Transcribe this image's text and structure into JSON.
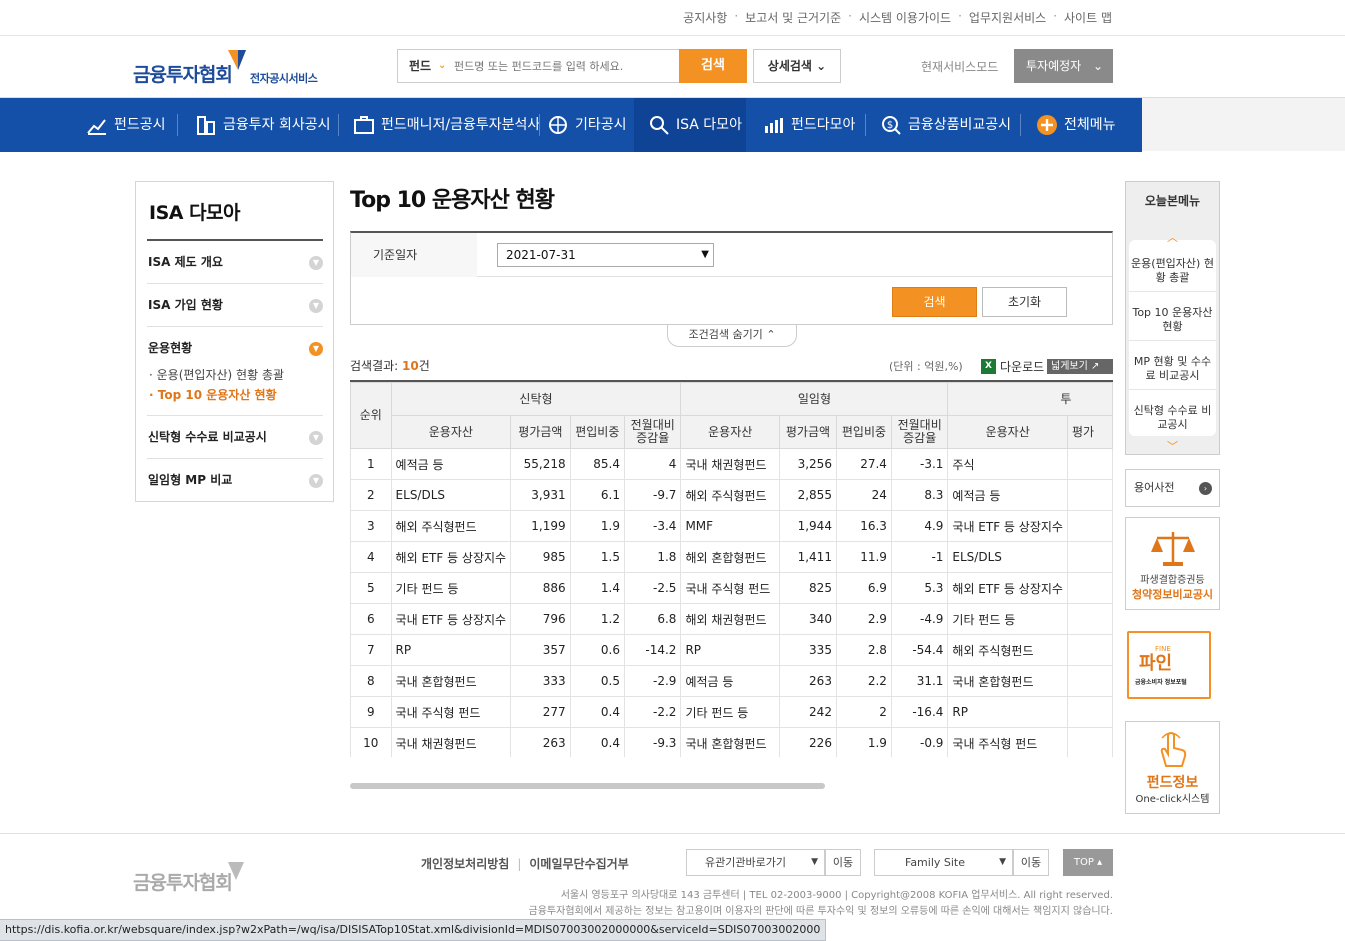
{
  "util_links": [
    "공지사항",
    "보고서 및 근거기준",
    "시스템 이용가이드",
    "업무지원서비스",
    "사이트 맵"
  ],
  "header": {
    "logo_main": "금융투자협회",
    "logo_sub": "전자공시서비스",
    "search_type": "펀드",
    "search_placeholder": "펀드명 또는 펀드코드를 입력 하세요.",
    "search_button": "검색",
    "detail_search": "상세검색",
    "mode_label": "현재서비스모드",
    "mode_value": "투자예정자"
  },
  "nav": {
    "items": [
      "펀드공시",
      "금융투자 회사공시",
      "펀드매니저/금융투자분석사",
      "기타공시",
      "ISA 다모아",
      "펀드다모아",
      "금융상품비교공시",
      "전체메뉴"
    ]
  },
  "sidebar": {
    "title": "ISA 다모아",
    "items": [
      "ISA 제도 개요",
      "ISA 가입 현황",
      "운용현황",
      "신탁형 수수료 비교공시",
      "일임형 MP 비교"
    ],
    "subitems": [
      "· 운용(편입자산) 현황 총괄",
      "· Top 10 운용자산 현황"
    ]
  },
  "main": {
    "title": "Top 10 운용자산 현황",
    "cond_label": "기준일자",
    "cond_value": "2021-07-31",
    "btn_search": "검색",
    "btn_reset": "초기화",
    "toggle": "조건검색 숨기기",
    "result_label": "검색결과:",
    "result_count": "10",
    "result_suffix": "건",
    "unit": "(단위 : 억원,%)",
    "download": "다운로드",
    "wide_view": "넓게보기"
  },
  "table": {
    "rank_header": "순위",
    "group_headers": [
      "신탁형",
      "일임형",
      "투"
    ],
    "col_headers": [
      "운용자산",
      "평가금액",
      "편입비중",
      "전월대비\n증감율"
    ],
    "col_headers_partial": [
      "운용자산",
      "평가"
    ],
    "rows": [
      [
        "1",
        "예적금 등",
        "55,218",
        "85.4",
        "4",
        "국내 채권형펀드",
        "3,256",
        "27.4",
        "-3.1",
        "주식"
      ],
      [
        "2",
        "ELS/DLS",
        "3,931",
        "6.1",
        "-9.7",
        "해외 주식형펀드",
        "2,855",
        "24",
        "8.3",
        "예적금 등"
      ],
      [
        "3",
        "해외 주식형펀드",
        "1,199",
        "1.9",
        "-3.4",
        "MMF",
        "1,944",
        "16.3",
        "4.9",
        "국내 ETF 등 상장지수"
      ],
      [
        "4",
        "해외 ETF 등 상장지수",
        "985",
        "1.5",
        "1.8",
        "해외 혼합형펀드",
        "1,411",
        "11.9",
        "-1",
        "ELS/DLS"
      ],
      [
        "5",
        "기타 펀드 등",
        "886",
        "1.4",
        "-2.5",
        "국내 주식형 펀드",
        "825",
        "6.9",
        "5.3",
        "해외 ETF 등 상장지수"
      ],
      [
        "6",
        "국내 ETF 등 상장지수",
        "796",
        "1.2",
        "6.8",
        "해외 채권형펀드",
        "340",
        "2.9",
        "-4.9",
        "기타 펀드 등"
      ],
      [
        "7",
        "RP",
        "357",
        "0.6",
        "-14.2",
        "RP",
        "335",
        "2.8",
        "-54.4",
        "해외 주식형펀드"
      ],
      [
        "8",
        "국내 혼합형펀드",
        "333",
        "0.5",
        "-2.9",
        "예적금 등",
        "263",
        "2.2",
        "31.1",
        "국내 혼합형펀드"
      ],
      [
        "9",
        "국내 주식형 펀드",
        "277",
        "0.4",
        "-2.2",
        "기타 펀드 등",
        "242",
        "2",
        "-16.4",
        "RP"
      ],
      [
        "10",
        "국내 채권형펀드",
        "263",
        "0.4",
        "-9.3",
        "국내 혼합형펀드",
        "226",
        "1.9",
        "-0.9",
        "국내 주식형 펀드"
      ]
    ]
  },
  "quick_menu": {
    "title": "오늘본메뉴",
    "links": [
      "운용(편입자산) 현황 총괄",
      "Top 10 운용자산 현황",
      "MP 현황 및 수수료 비교공시",
      "신탁형 수수료 비교공시"
    ],
    "dict": "용어사전",
    "banner1_line1": "파생결합증권등",
    "banner1_line2": "청약정보비교공시",
    "banner2_small": "FINE",
    "banner2_main": "파인",
    "banner2_sub": "금융소비자 정보포털",
    "banner3_line1": "펀드정보",
    "banner3_line2": "One-click시스템"
  },
  "footer": {
    "logo": "금융투자협회",
    "links": [
      "개인정보처리방침",
      "이메일무단수집거부"
    ],
    "select1": "유관기관바로가기",
    "select2": "Family Site",
    "go": "이동",
    "top": "TOP",
    "address": "서울시 영등포구 의사당대로 143 금투센터 | TEL 02-2003-9000 | Copyright@2008 KOFIA 업무서비스. All right reserved.",
    "disclaimer": "금융투자협회에서 제공하는 정보는 참고용이며 이용자의 판단에 따른 투자수익 및 정보의 오류등에 따른 손익에 대해서는 책임지지 않습니다."
  },
  "status_url": "https://dis.kofia.or.kr/websquare/index.jsp?w2xPath=/wq/isa/DISISATop10Stat.xml&divisionId=MDIS07003002000000&serviceId=SDIS07003002000",
  "colors": {
    "primary_blue": "#1450a8",
    "accent_orange": "#f39122"
  }
}
